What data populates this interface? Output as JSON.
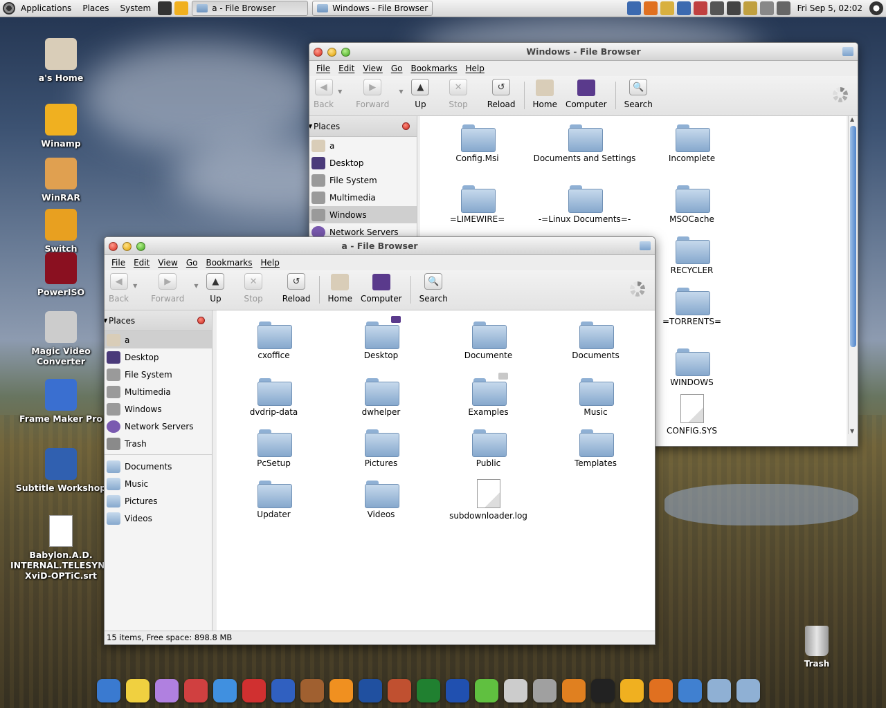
{
  "top_panel": {
    "menus": [
      "Applications",
      "Places",
      "System"
    ],
    "tasks": [
      {
        "label": "a - File Browser",
        "active": true
      },
      {
        "label": "Windows - File Browser",
        "active": false
      }
    ],
    "clock": "Fri Sep  5, 02:02"
  },
  "desktop_icons": [
    {
      "label": "a's Home",
      "icon": "home-icon",
      "color": "#d9cdb8"
    },
    {
      "label": "Winamp",
      "icon": "winamp-icon",
      "color": "#f0b020"
    },
    {
      "label": "WinRAR",
      "icon": "winrar-icon",
      "color": "#e0a050"
    },
    {
      "label": "Switch",
      "icon": "switch-icon",
      "color": "#e8a020"
    },
    {
      "label": "PowerISO",
      "icon": "poweriso-icon",
      "color": "#8a1020"
    },
    {
      "label": "Magic Video Converter",
      "icon": "film-reel-icon",
      "color": "#cccccc"
    },
    {
      "label": "Frame Maker Pro",
      "icon": "frame-maker-icon",
      "color": "#3a6fd0"
    },
    {
      "label": "Subtitle Workshop",
      "icon": "clapper-icon",
      "color": "#3060b0"
    },
    {
      "label": "Babylon.A.D. INTERNAL.TELESYNC XviD-OPTiC.srt",
      "icon": "document-icon",
      "color": "#ffffff"
    }
  ],
  "trash_desktop": {
    "label": "Trash"
  },
  "win_back": {
    "title": "Windows - File Browser",
    "menu": [
      "File",
      "Edit",
      "View",
      "Go",
      "Bookmarks",
      "Help"
    ],
    "toolbar": {
      "back": "Back",
      "forward": "Forward",
      "up": "Up",
      "stop": "Stop",
      "reload": "Reload",
      "home": "Home",
      "computer": "Computer",
      "search": "Search"
    },
    "places_label": "Places",
    "sidebar": [
      {
        "label": "a",
        "icon": "home-icon",
        "selected": false
      },
      {
        "label": "Desktop",
        "icon": "desktop-icon",
        "selected": false
      },
      {
        "label": "File System",
        "icon": "drive-icon",
        "selected": false
      },
      {
        "label": "Multimedia",
        "icon": "drive-icon",
        "selected": false
      },
      {
        "label": "Windows",
        "icon": "drive-icon",
        "selected": true
      },
      {
        "label": "Network Servers",
        "icon": "network-icon",
        "selected": false
      }
    ],
    "items": [
      {
        "label": "Config.Msi",
        "type": "folder"
      },
      {
        "label": "Documents and Settings",
        "type": "folder"
      },
      {
        "label": "Incomplete",
        "type": "folder"
      },
      {
        "label": "=LIMEWIRE=",
        "type": "folder"
      },
      {
        "label": "-=Linux Documents=-",
        "type": "folder"
      },
      {
        "label": "MSOCache",
        "type": "folder"
      },
      {
        "label": "RECYCLER",
        "type": "folder"
      },
      {
        "label": "=TORRENTS=",
        "type": "folder"
      },
      {
        "label": "WINDOWS",
        "type": "folder"
      },
      {
        "label": "CONFIG.SYS",
        "type": "file"
      }
    ]
  },
  "win_front": {
    "title": "a - File Browser",
    "menu": [
      "File",
      "Edit",
      "View",
      "Go",
      "Bookmarks",
      "Help"
    ],
    "toolbar": {
      "back": "Back",
      "forward": "Forward",
      "up": "Up",
      "stop": "Stop",
      "reload": "Reload",
      "home": "Home",
      "computer": "Computer",
      "search": "Search"
    },
    "places_label": "Places",
    "sidebar": [
      {
        "label": "a",
        "icon": "home-icon",
        "selected": true
      },
      {
        "label": "Desktop",
        "icon": "desktop-icon",
        "selected": false
      },
      {
        "label": "File System",
        "icon": "drive-icon",
        "selected": false
      },
      {
        "label": "Multimedia",
        "icon": "drive-icon",
        "selected": false
      },
      {
        "label": "Windows",
        "icon": "drive-icon",
        "selected": false
      },
      {
        "label": "Network Servers",
        "icon": "network-icon",
        "selected": false
      },
      {
        "label": "Trash",
        "icon": "trash-icon",
        "selected": false
      }
    ],
    "bookmarks": [
      "Documents",
      "Music",
      "Pictures",
      "Videos"
    ],
    "items": [
      {
        "label": "cxoffice",
        "type": "folder"
      },
      {
        "label": "Desktop",
        "type": "folder",
        "emblem": "desktop"
      },
      {
        "label": "Documente",
        "type": "folder"
      },
      {
        "label": "Documents",
        "type": "folder"
      },
      {
        "label": "dvdrip-data",
        "type": "folder"
      },
      {
        "label": "dwhelper",
        "type": "folder"
      },
      {
        "label": "Examples",
        "type": "folder",
        "emblem": "lock"
      },
      {
        "label": "Music",
        "type": "folder"
      },
      {
        "label": "PcSetup",
        "type": "folder"
      },
      {
        "label": "Pictures",
        "type": "folder"
      },
      {
        "label": "Public",
        "type": "folder"
      },
      {
        "label": "Templates",
        "type": "folder"
      },
      {
        "label": "Updater",
        "type": "folder"
      },
      {
        "label": "Videos",
        "type": "folder"
      },
      {
        "label": "subdownloader.log",
        "type": "file"
      }
    ],
    "status": "15 items, Free space: 898.8 MB"
  },
  "dock": [
    "globe-icon",
    "pidgin-icon",
    "messenger-icon",
    "gift-icon",
    "itunes-icon",
    "creative-suite-icon",
    "media-player-icon",
    "paint-icon",
    "vlc-icon",
    "music-icon",
    "archive-icon",
    "video-editor-icon",
    "word-icon",
    "limewire-icon",
    "printer-icon",
    "download-icon",
    "switch-icon",
    "terminal-icon",
    "winamp-icon",
    "firefox-icon",
    "editor-icon",
    "folder-icon",
    "folder-icon"
  ],
  "dock_colors": [
    "#3a7ad0",
    "#f0d040",
    "#b080e0",
    "#d04040",
    "#4090e0",
    "#d03030",
    "#3060c0",
    "#a06030",
    "#f09020",
    "#2050a0",
    "#c05030",
    "#208030",
    "#2050b0",
    "#60c040",
    "#cccccc",
    "#a0a0a0",
    "#e08020",
    "#222222",
    "#f0b020",
    "#e07020",
    "#4080d0",
    "#8fb0d4",
    "#8fb0d4"
  ]
}
